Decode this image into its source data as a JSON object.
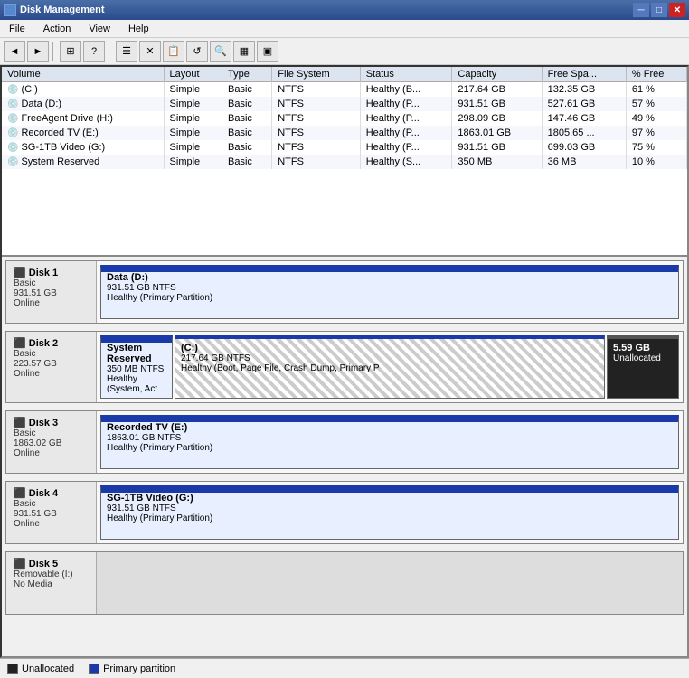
{
  "titleBar": {
    "title": "Disk Management",
    "icon": "disk-mgmt-icon"
  },
  "menu": {
    "items": [
      "File",
      "Action",
      "View",
      "Help"
    ]
  },
  "toolbar": {
    "buttons": [
      "◄",
      "►",
      "⊞",
      "?",
      "⊟",
      "☰",
      "✕",
      "📋",
      "🔄",
      "🔍",
      "📊",
      "🖥"
    ]
  },
  "table": {
    "columns": [
      "Volume",
      "Layout",
      "Type",
      "File System",
      "Status",
      "Capacity",
      "Free Spa...",
      "% Free"
    ],
    "rows": [
      {
        "volume": "(C:)",
        "layout": "Simple",
        "type": "Basic",
        "fs": "NTFS",
        "status": "Healthy (B...",
        "capacity": "217.64 GB",
        "free": "132.35 GB",
        "pct": "61 %"
      },
      {
        "volume": "Data (D:)",
        "layout": "Simple",
        "type": "Basic",
        "fs": "NTFS",
        "status": "Healthy (P...",
        "capacity": "931.51 GB",
        "free": "527.61 GB",
        "pct": "57 %"
      },
      {
        "volume": "FreeAgent Drive (H:)",
        "layout": "Simple",
        "type": "Basic",
        "fs": "NTFS",
        "status": "Healthy (P...",
        "capacity": "298.09 GB",
        "free": "147.46 GB",
        "pct": "49 %"
      },
      {
        "volume": "Recorded TV (E:)",
        "layout": "Simple",
        "type": "Basic",
        "fs": "NTFS",
        "status": "Healthy (P...",
        "capacity": "1863.01 GB",
        "free": "1805.65 ...",
        "pct": "97 %"
      },
      {
        "volume": "SG-1TB Video (G:)",
        "layout": "Simple",
        "type": "Basic",
        "fs": "NTFS",
        "status": "Healthy (P...",
        "capacity": "931.51 GB",
        "free": "699.03 GB",
        "pct": "75 %"
      },
      {
        "volume": "System Reserved",
        "layout": "Simple",
        "type": "Basic",
        "fs": "NTFS",
        "status": "Healthy (S...",
        "capacity": "350 MB",
        "free": "36 MB",
        "pct": "10 %"
      }
    ]
  },
  "disks": [
    {
      "id": "Disk 1",
      "type": "Basic",
      "size": "931.51 GB",
      "status": "Online",
      "partitions": [
        {
          "name": "Data (D:)",
          "size": "931.51 GB NTFS",
          "status": "Healthy (Primary Partition)",
          "style": "primary",
          "flex": 10
        }
      ]
    },
    {
      "id": "Disk 2",
      "type": "Basic",
      "size": "223.57 GB",
      "status": "Online",
      "partitions": [
        {
          "name": "System Reserved",
          "size": "350 MB NTFS",
          "status": "Healthy (System, Act",
          "style": "primary",
          "flex": 1
        },
        {
          "name": "(C:)",
          "size": "217.64 GB NTFS",
          "status": "Healthy (Boot, Page File, Crash Dump, Primary P",
          "style": "hatched",
          "flex": 7
        },
        {
          "name": "5.59 GB",
          "size": "Unallocated",
          "status": "",
          "style": "unallocated",
          "flex": 1
        }
      ]
    },
    {
      "id": "Disk 3",
      "type": "Basic",
      "size": "1863.02 GB",
      "status": "Online",
      "partitions": [
        {
          "name": "Recorded TV  (E:)",
          "size": "1863.01 GB NTFS",
          "status": "Healthy (Primary Partition)",
          "style": "primary",
          "flex": 10
        }
      ]
    },
    {
      "id": "Disk 4",
      "type": "Basic",
      "size": "931.51 GB",
      "status": "Online",
      "partitions": [
        {
          "name": "SG-1TB Video (G:)",
          "size": "931.51 GB NTFS",
          "status": "Healthy (Primary Partition)",
          "style": "primary",
          "flex": 10
        }
      ]
    },
    {
      "id": "Disk 5",
      "type": "Removable (I:)",
      "size": "",
      "status": "No Media",
      "partitions": []
    }
  ],
  "legend": {
    "unallocated": "Unallocated",
    "primary": "Primary partition"
  }
}
